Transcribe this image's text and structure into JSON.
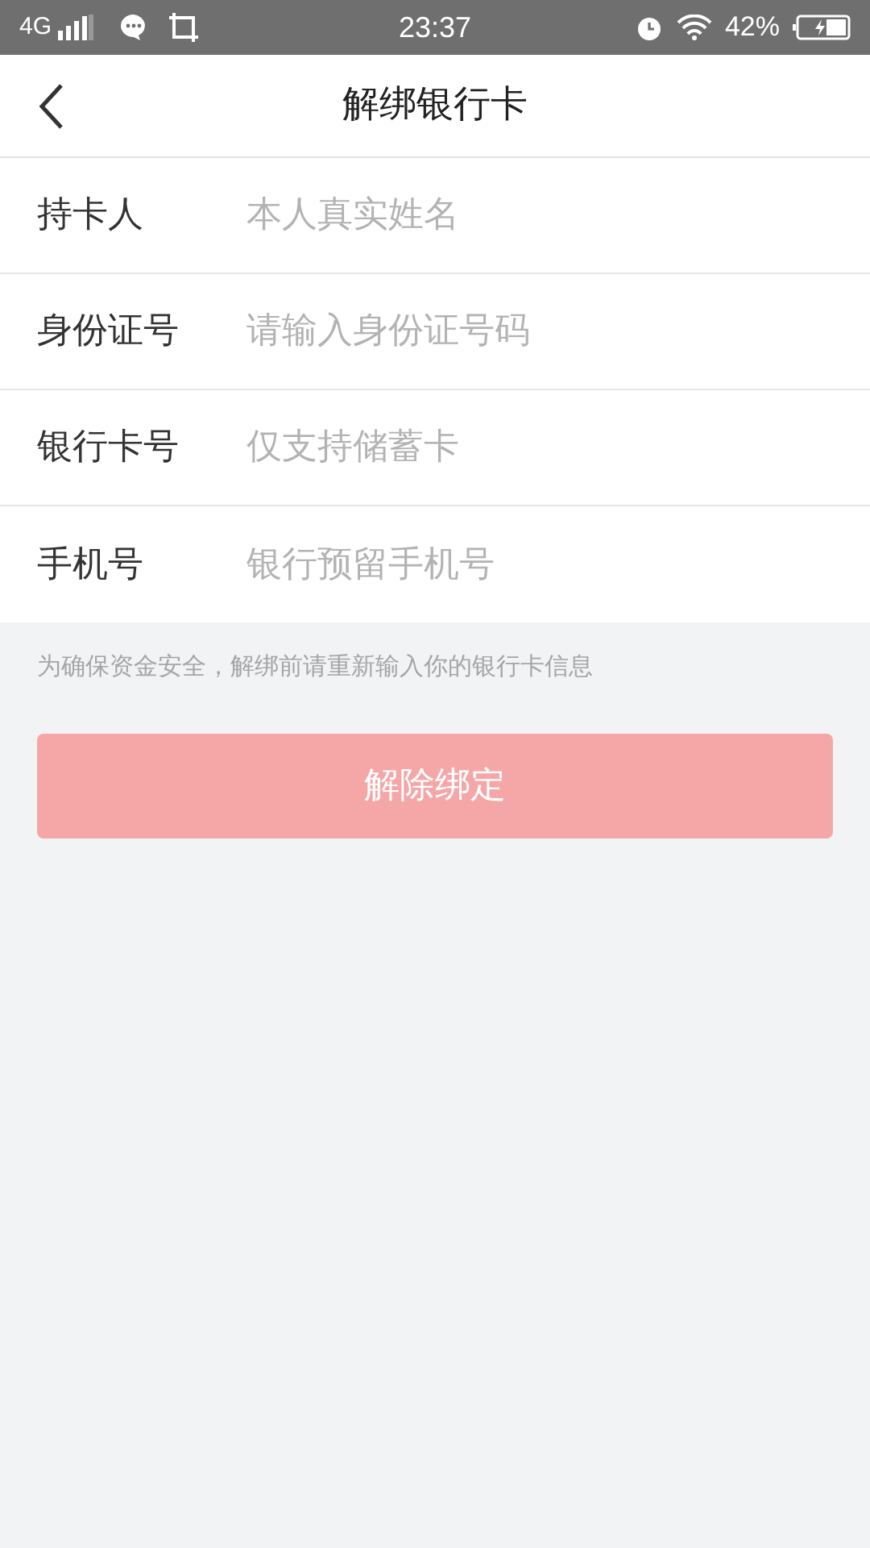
{
  "status_bar": {
    "network": "4G",
    "time": "23:37",
    "battery": "42%"
  },
  "header": {
    "title": "解绑银行卡"
  },
  "fields": [
    {
      "label": "持卡人",
      "placeholder": "本人真实姓名"
    },
    {
      "label": "身份证号",
      "placeholder": "请输入身份证号码"
    },
    {
      "label": "银行卡号",
      "placeholder": "仅支持储蓄卡"
    },
    {
      "label": "手机号",
      "placeholder": "银行预留手机号"
    }
  ],
  "notice": "为确保资金安全，解绑前请重新输入你的银行卡信息",
  "submit_button": {
    "label": "解除绑定",
    "disabled": true
  }
}
